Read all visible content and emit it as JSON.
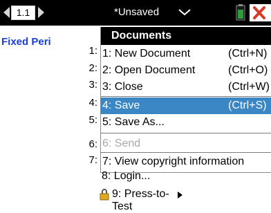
{
  "tabbar": {
    "tab_label": "1.1",
    "document_title": "*Unsaved",
    "icons": [
      "arrow-left-icon",
      "arrow-right-icon",
      "chevron-down-icon",
      "battery-icon",
      "close-icon"
    ]
  },
  "content": {
    "page_text": "Fixed Peri"
  },
  "background_numbers": [
    "1:",
    "2:",
    "3:",
    "4:",
    "5:",
    "6:",
    "7:"
  ],
  "menu": {
    "title": "Documents",
    "items": [
      {
        "label": "1: New Document",
        "shortcut": "(Ctrl+N)",
        "state": "normal"
      },
      {
        "label": "2: Open Document",
        "shortcut": "(Ctrl+O)",
        "state": "normal"
      },
      {
        "label": "3: Close",
        "shortcut": "(Ctrl+W)",
        "state": "normal"
      },
      {
        "label": "4: Save",
        "shortcut": "(Ctrl+S)",
        "state": "selected"
      },
      {
        "label": "5: Save As...",
        "shortcut": "",
        "state": "normal"
      },
      {
        "label": "6: Send",
        "shortcut": "",
        "state": "disabled"
      },
      {
        "label": "7: View copyright information",
        "shortcut": "",
        "state": "normal"
      }
    ]
  },
  "login_label": "8: Login...",
  "press_to_test_label": "9: Press-to-Test",
  "colors": {
    "bar": "#000000",
    "link_blue": "#1a3fd6",
    "selection": "#3b86c4",
    "disabled": "#a8a8a8",
    "battery_green": "#2e9e3a",
    "close_red": "#d83a2a",
    "lock_gold": "#e0a81c"
  }
}
